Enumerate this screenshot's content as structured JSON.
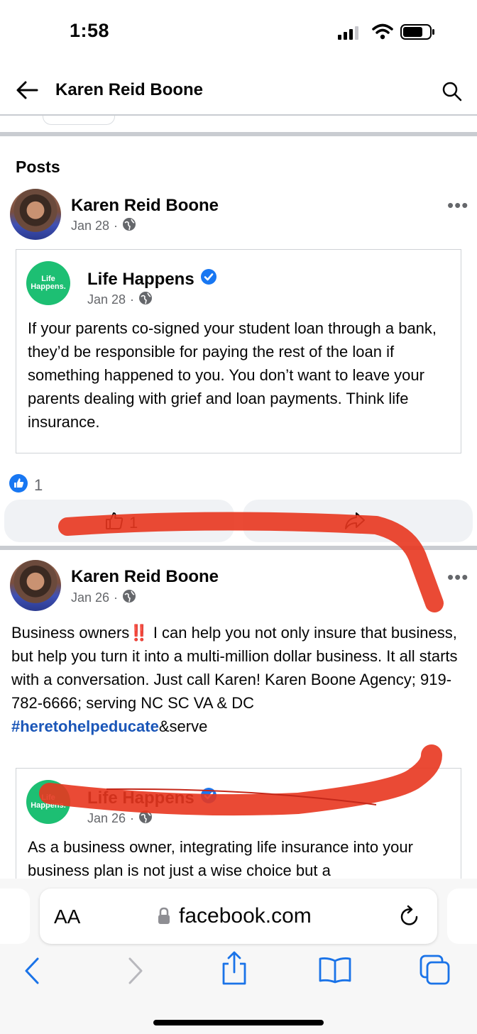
{
  "status": {
    "time": "1:58"
  },
  "header": {
    "title": "Karen Reid Boone"
  },
  "section": {
    "title": "Posts"
  },
  "posts": [
    {
      "author": "Karen Reid Boone",
      "date": "Jan 28",
      "shared": {
        "logo_text": "Life Happens.",
        "author": "Life Happens",
        "date": "Jan 28",
        "text": "If your parents co-signed your student loan through a bank, they’d be responsible for paying the rest of the loan if something happened to you. You don’t want to leave your parents dealing with grief and loan payments. Think life insurance."
      },
      "reaction_count": "1",
      "like_count": "1"
    },
    {
      "author": "Karen Reid Boone",
      "date": "Jan 26",
      "text_before": "Business owners",
      "emphasis": "‼️",
      "text_after": " I can help you not only insure that business,  but help you turn it into a multi-million dollar business. It all starts with a conversation. Just call Karen! Karen Boone Agency; 919-782-6666; serving NC SC VA & DC",
      "hashtag": "#heretohelpeducate",
      "hashtag_suffix": "&serve",
      "shared": {
        "logo_text": "Life Happens.",
        "author": "Life Happens",
        "date": "Jan 26",
        "text": "As a business owner, integrating life insurance into your business plan is not just a wise choice but a"
      }
    }
  ],
  "browser": {
    "text_size_label": "AA",
    "url": "facebook.com"
  },
  "colors": {
    "verified": "#1877f2",
    "brand_green": "#1dbf73",
    "annotation_red": "#e8361f",
    "ios_blue": "#1a73e8"
  }
}
